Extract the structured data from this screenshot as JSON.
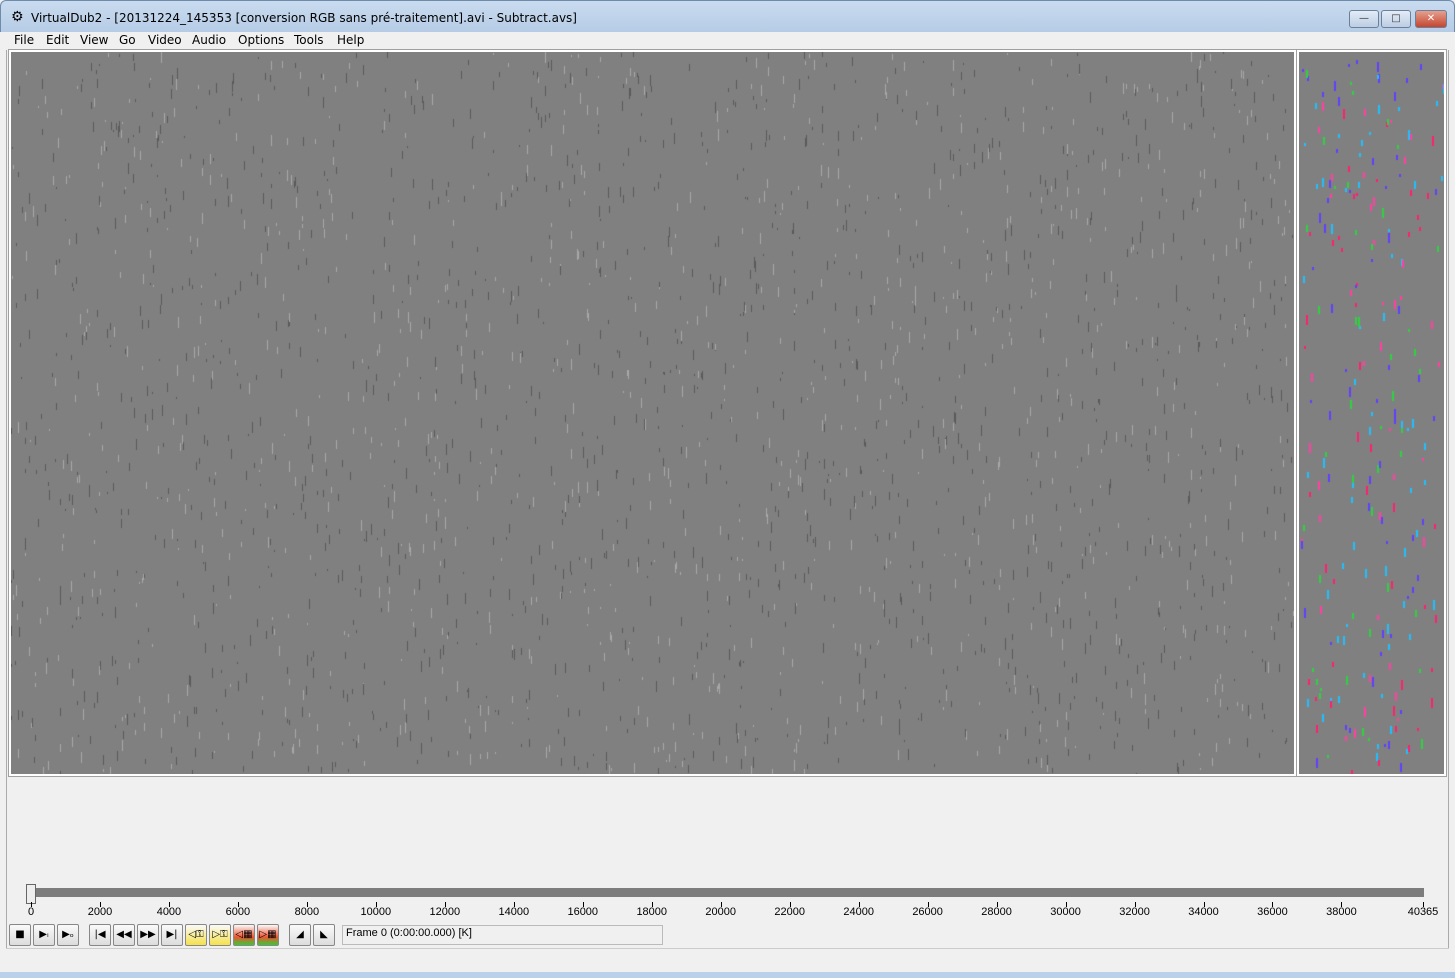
{
  "window": {
    "title": "VirtualDub2  - [20131224_145353 [conversion RGB sans pré-traitement].avi - Subtract.avs]",
    "minimize": "—",
    "maximize": "□",
    "close": "✕"
  },
  "menu": [
    "File",
    "Edit",
    "View",
    "Go",
    "Video",
    "Audio",
    "Options",
    "Tools",
    "Help"
  ],
  "timeline": {
    "labels": [
      "0",
      "2000",
      "4000",
      "6000",
      "8000",
      "10000",
      "12000",
      "14000",
      "16000",
      "18000",
      "20000",
      "22000",
      "24000",
      "26000",
      "28000",
      "30000",
      "32000",
      "34000",
      "36000",
      "38000",
      "40365"
    ],
    "max": 40365,
    "position": 0
  },
  "toolbar": {
    "buttons": [
      {
        "name": "stop",
        "glyph": "■"
      },
      {
        "name": "play-input",
        "glyph": "▶ᵢ"
      },
      {
        "name": "play-output",
        "glyph": "▶ₒ"
      },
      {
        "name": "go-start",
        "glyph": "|◀"
      },
      {
        "name": "prev-frame",
        "glyph": "◀◀"
      },
      {
        "name": "next-frame",
        "glyph": "▶▶"
      },
      {
        "name": "go-end",
        "glyph": "▶|"
      },
      {
        "name": "prev-keyframe",
        "glyph": "◁⚿"
      },
      {
        "name": "next-keyframe",
        "glyph": "▷⚿"
      },
      {
        "name": "prev-scene",
        "glyph": "◁▦"
      },
      {
        "name": "next-scene",
        "glyph": "▷▦"
      },
      {
        "name": "mark-in",
        "glyph": "◢"
      },
      {
        "name": "mark-out",
        "glyph": "◣"
      }
    ]
  },
  "frame_status": "Frame 0 (0:00:00.000) [K]"
}
